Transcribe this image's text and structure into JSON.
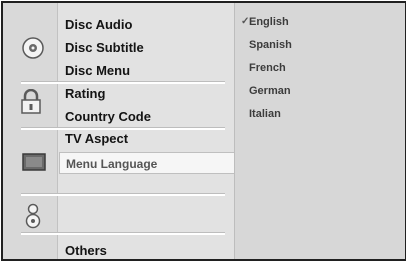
{
  "menu": {
    "items": [
      {
        "label": "Disc Audio"
      },
      {
        "label": "Disc Subtitle"
      },
      {
        "label": "Disc Menu"
      },
      {
        "label": "Rating"
      },
      {
        "label": "Country Code"
      },
      {
        "label": "TV Aspect"
      },
      {
        "label": "Menu Language"
      },
      {
        "label": "Others"
      }
    ],
    "selected": "Menu Language"
  },
  "options": {
    "languages": [
      {
        "label": "English",
        "checked": true,
        "check_mark": "✓"
      },
      {
        "label": "Spanish"
      },
      {
        "label": "French"
      },
      {
        "label": "German"
      },
      {
        "label": "Italian"
      }
    ]
  },
  "icons": {
    "disc": "disc-icon",
    "lock": "lock-icon",
    "tv": "tv-screen-icon",
    "speaker": "speaker-icon"
  }
}
